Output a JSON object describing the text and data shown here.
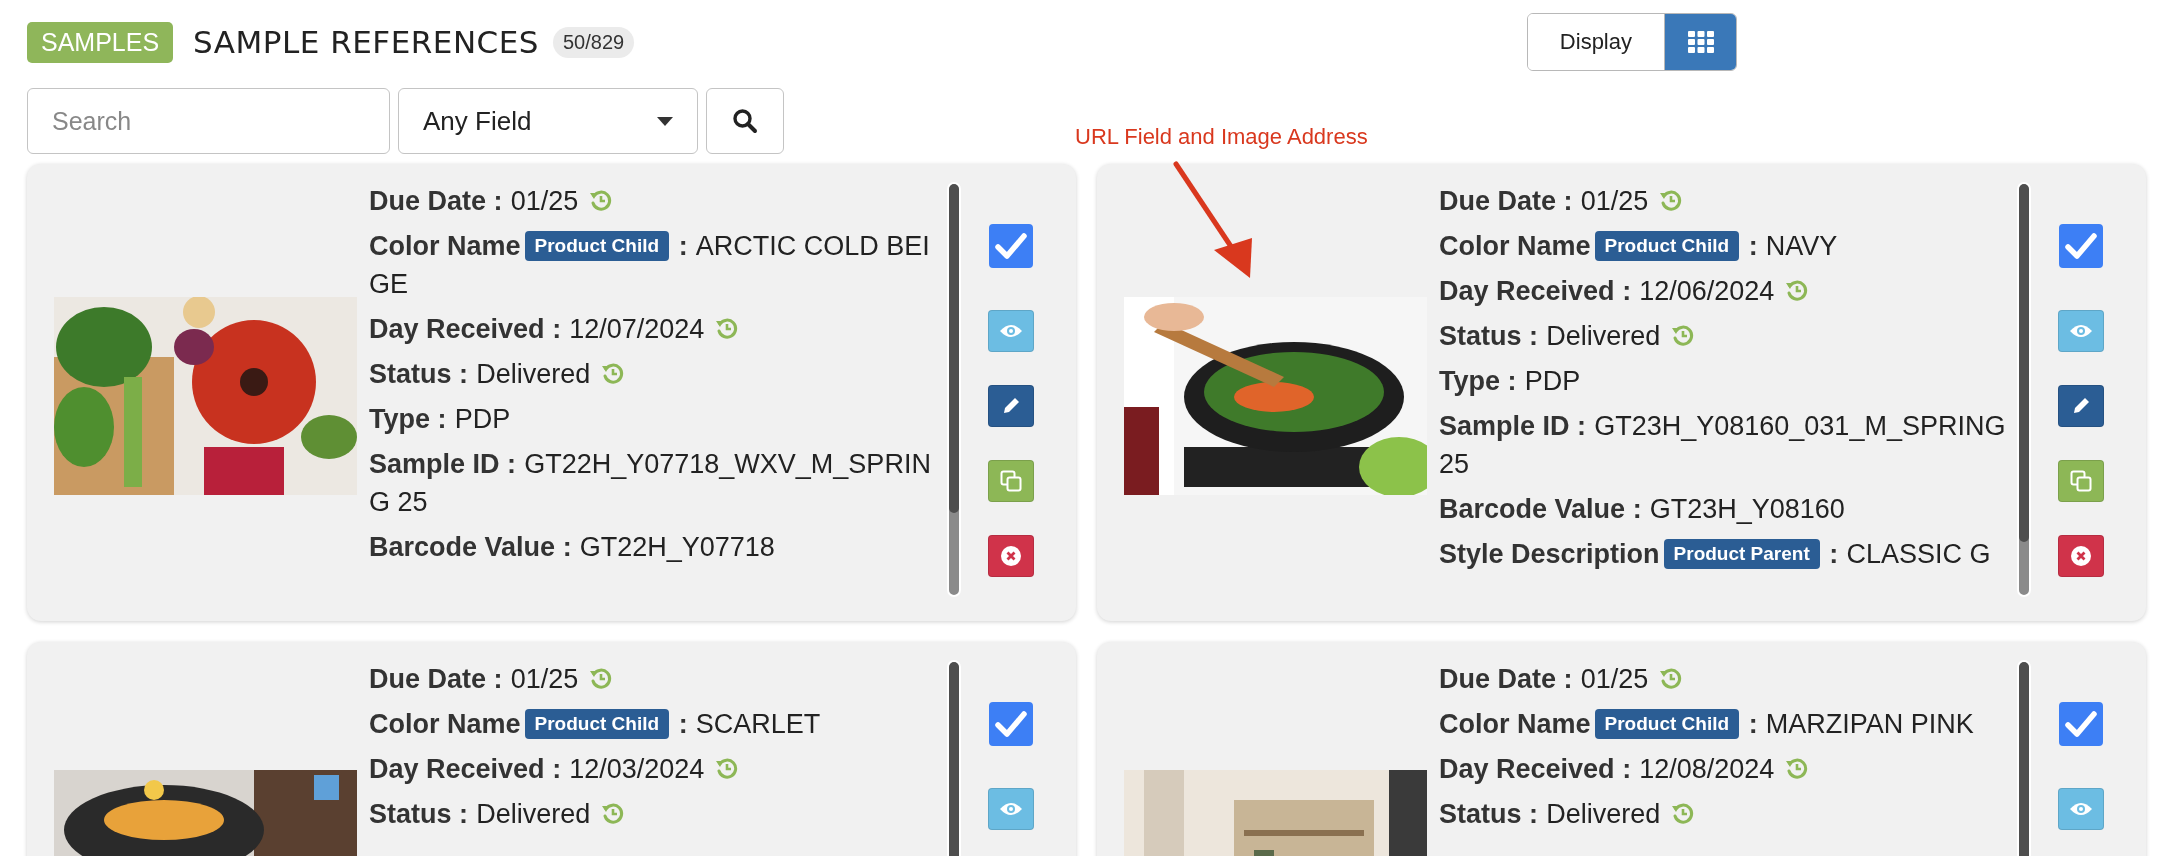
{
  "header": {
    "section_badge": "SAMPLES",
    "title": "SAMPLE REFERENCES",
    "count": "50/829"
  },
  "view_toggle": {
    "label": "Display",
    "grid_selected": true
  },
  "search": {
    "placeholder": "Search",
    "field_select": "Any Field"
  },
  "annotation": {
    "text": "URL Field and Image Address"
  },
  "cards": [
    {
      "checked": true,
      "fields": [
        {
          "label": "Due Date",
          "separator": ":",
          "value": "01/25",
          "history": true
        },
        {
          "label": "Color Name",
          "badge": "Product Child",
          "separator": ":",
          "value": "ARCTIC COLD BEIGE",
          "history": false
        },
        {
          "label": "Day Received",
          "separator": ":",
          "value": "12/07/2024",
          "history": true
        },
        {
          "label": "Status",
          "separator": ":",
          "value": "Delivered",
          "history": true
        },
        {
          "label": "Type",
          "separator": ":",
          "value": "PDP",
          "history": false
        },
        {
          "label": "Sample ID",
          "separator": ":",
          "value": "GT22H_Y07718_WXV_M_SPRING 25",
          "history": false
        },
        {
          "label": "Barcode Value",
          "separator": ":",
          "value": "GT22H_Y07718",
          "history": false
        }
      ]
    },
    {
      "checked": true,
      "fields": [
        {
          "label": "Due Date",
          "separator": ":",
          "value": "01/25",
          "history": true
        },
        {
          "label": "Color Name",
          "badge": "Product Child",
          "separator": ":",
          "value": "NAVY",
          "history": false
        },
        {
          "label": "Day Received",
          "separator": ":",
          "value": "12/06/2024",
          "history": true
        },
        {
          "label": "Status",
          "separator": ":",
          "value": "Delivered",
          "history": true
        },
        {
          "label": "Type",
          "separator": ":",
          "value": "PDP",
          "history": false
        },
        {
          "label": "Sample ID",
          "separator": ":",
          "value": "GT23H_Y08160_031_M_SPRING 25",
          "history": false
        },
        {
          "label": "Barcode Value",
          "separator": ":",
          "value": "GT23H_Y08160",
          "history": false
        },
        {
          "label": "Style Description",
          "badge": "Product Parent",
          "separator": ":",
          "value": "CLASSIC G",
          "history": false
        }
      ]
    },
    {
      "checked": true,
      "fields": [
        {
          "label": "Due Date",
          "separator": ":",
          "value": "01/25",
          "history": true
        },
        {
          "label": "Color Name",
          "badge": "Product Child",
          "separator": ":",
          "value": "SCARLET",
          "history": false
        },
        {
          "label": "Day Received",
          "separator": ":",
          "value": "12/03/2024",
          "history": true
        },
        {
          "label": "Status",
          "separator": ":",
          "value": "Delivered",
          "history": true
        }
      ]
    },
    {
      "checked": true,
      "fields": [
        {
          "label": "Due Date",
          "separator": ":",
          "value": "01/25",
          "history": true
        },
        {
          "label": "Color Name",
          "badge": "Product Child",
          "separator": ":",
          "value": "MARZIPAN PINK",
          "history": false
        },
        {
          "label": "Day Received",
          "separator": ":",
          "value": "12/08/2024",
          "history": true
        },
        {
          "label": "Status",
          "separator": ":",
          "value": "Delivered",
          "history": true
        }
      ]
    }
  ]
}
